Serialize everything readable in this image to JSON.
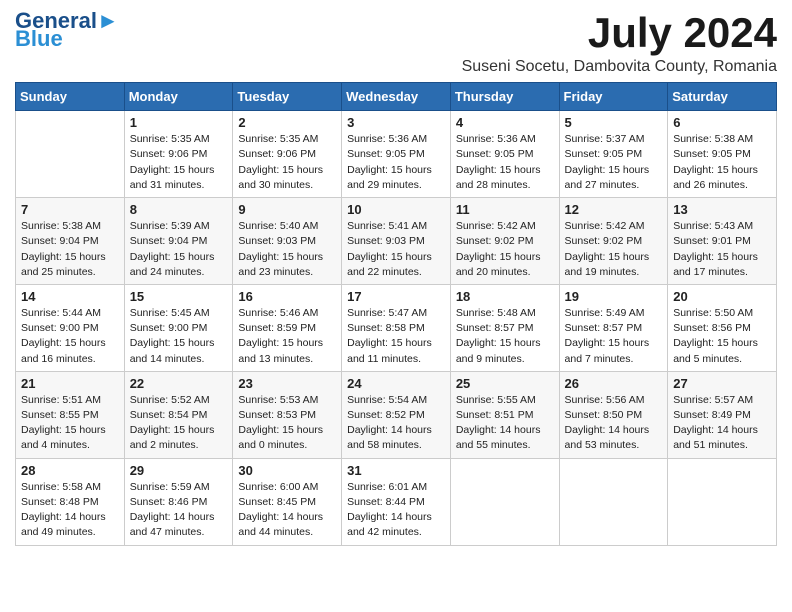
{
  "header": {
    "logo_line1": "General",
    "logo_line2": "Blue",
    "month": "July 2024",
    "location": "Suseni Socetu, Dambovita County, Romania"
  },
  "weekdays": [
    "Sunday",
    "Monday",
    "Tuesday",
    "Wednesday",
    "Thursday",
    "Friday",
    "Saturday"
  ],
  "weeks": [
    [
      {
        "day": "",
        "info": ""
      },
      {
        "day": "1",
        "info": "Sunrise: 5:35 AM\nSunset: 9:06 PM\nDaylight: 15 hours\nand 31 minutes."
      },
      {
        "day": "2",
        "info": "Sunrise: 5:35 AM\nSunset: 9:06 PM\nDaylight: 15 hours\nand 30 minutes."
      },
      {
        "day": "3",
        "info": "Sunrise: 5:36 AM\nSunset: 9:05 PM\nDaylight: 15 hours\nand 29 minutes."
      },
      {
        "day": "4",
        "info": "Sunrise: 5:36 AM\nSunset: 9:05 PM\nDaylight: 15 hours\nand 28 minutes."
      },
      {
        "day": "5",
        "info": "Sunrise: 5:37 AM\nSunset: 9:05 PM\nDaylight: 15 hours\nand 27 minutes."
      },
      {
        "day": "6",
        "info": "Sunrise: 5:38 AM\nSunset: 9:05 PM\nDaylight: 15 hours\nand 26 minutes."
      }
    ],
    [
      {
        "day": "7",
        "info": "Sunrise: 5:38 AM\nSunset: 9:04 PM\nDaylight: 15 hours\nand 25 minutes."
      },
      {
        "day": "8",
        "info": "Sunrise: 5:39 AM\nSunset: 9:04 PM\nDaylight: 15 hours\nand 24 minutes."
      },
      {
        "day": "9",
        "info": "Sunrise: 5:40 AM\nSunset: 9:03 PM\nDaylight: 15 hours\nand 23 minutes."
      },
      {
        "day": "10",
        "info": "Sunrise: 5:41 AM\nSunset: 9:03 PM\nDaylight: 15 hours\nand 22 minutes."
      },
      {
        "day": "11",
        "info": "Sunrise: 5:42 AM\nSunset: 9:02 PM\nDaylight: 15 hours\nand 20 minutes."
      },
      {
        "day": "12",
        "info": "Sunrise: 5:42 AM\nSunset: 9:02 PM\nDaylight: 15 hours\nand 19 minutes."
      },
      {
        "day": "13",
        "info": "Sunrise: 5:43 AM\nSunset: 9:01 PM\nDaylight: 15 hours\nand 17 minutes."
      }
    ],
    [
      {
        "day": "14",
        "info": "Sunrise: 5:44 AM\nSunset: 9:00 PM\nDaylight: 15 hours\nand 16 minutes."
      },
      {
        "day": "15",
        "info": "Sunrise: 5:45 AM\nSunset: 9:00 PM\nDaylight: 15 hours\nand 14 minutes."
      },
      {
        "day": "16",
        "info": "Sunrise: 5:46 AM\nSunset: 8:59 PM\nDaylight: 15 hours\nand 13 minutes."
      },
      {
        "day": "17",
        "info": "Sunrise: 5:47 AM\nSunset: 8:58 PM\nDaylight: 15 hours\nand 11 minutes."
      },
      {
        "day": "18",
        "info": "Sunrise: 5:48 AM\nSunset: 8:57 PM\nDaylight: 15 hours\nand 9 minutes."
      },
      {
        "day": "19",
        "info": "Sunrise: 5:49 AM\nSunset: 8:57 PM\nDaylight: 15 hours\nand 7 minutes."
      },
      {
        "day": "20",
        "info": "Sunrise: 5:50 AM\nSunset: 8:56 PM\nDaylight: 15 hours\nand 5 minutes."
      }
    ],
    [
      {
        "day": "21",
        "info": "Sunrise: 5:51 AM\nSunset: 8:55 PM\nDaylight: 15 hours\nand 4 minutes."
      },
      {
        "day": "22",
        "info": "Sunrise: 5:52 AM\nSunset: 8:54 PM\nDaylight: 15 hours\nand 2 minutes."
      },
      {
        "day": "23",
        "info": "Sunrise: 5:53 AM\nSunset: 8:53 PM\nDaylight: 15 hours\nand 0 minutes."
      },
      {
        "day": "24",
        "info": "Sunrise: 5:54 AM\nSunset: 8:52 PM\nDaylight: 14 hours\nand 58 minutes."
      },
      {
        "day": "25",
        "info": "Sunrise: 5:55 AM\nSunset: 8:51 PM\nDaylight: 14 hours\nand 55 minutes."
      },
      {
        "day": "26",
        "info": "Sunrise: 5:56 AM\nSunset: 8:50 PM\nDaylight: 14 hours\nand 53 minutes."
      },
      {
        "day": "27",
        "info": "Sunrise: 5:57 AM\nSunset: 8:49 PM\nDaylight: 14 hours\nand 51 minutes."
      }
    ],
    [
      {
        "day": "28",
        "info": "Sunrise: 5:58 AM\nSunset: 8:48 PM\nDaylight: 14 hours\nand 49 minutes."
      },
      {
        "day": "29",
        "info": "Sunrise: 5:59 AM\nSunset: 8:46 PM\nDaylight: 14 hours\nand 47 minutes."
      },
      {
        "day": "30",
        "info": "Sunrise: 6:00 AM\nSunset: 8:45 PM\nDaylight: 14 hours\nand 44 minutes."
      },
      {
        "day": "31",
        "info": "Sunrise: 6:01 AM\nSunset: 8:44 PM\nDaylight: 14 hours\nand 42 minutes."
      },
      {
        "day": "",
        "info": ""
      },
      {
        "day": "",
        "info": ""
      },
      {
        "day": "",
        "info": ""
      }
    ]
  ]
}
